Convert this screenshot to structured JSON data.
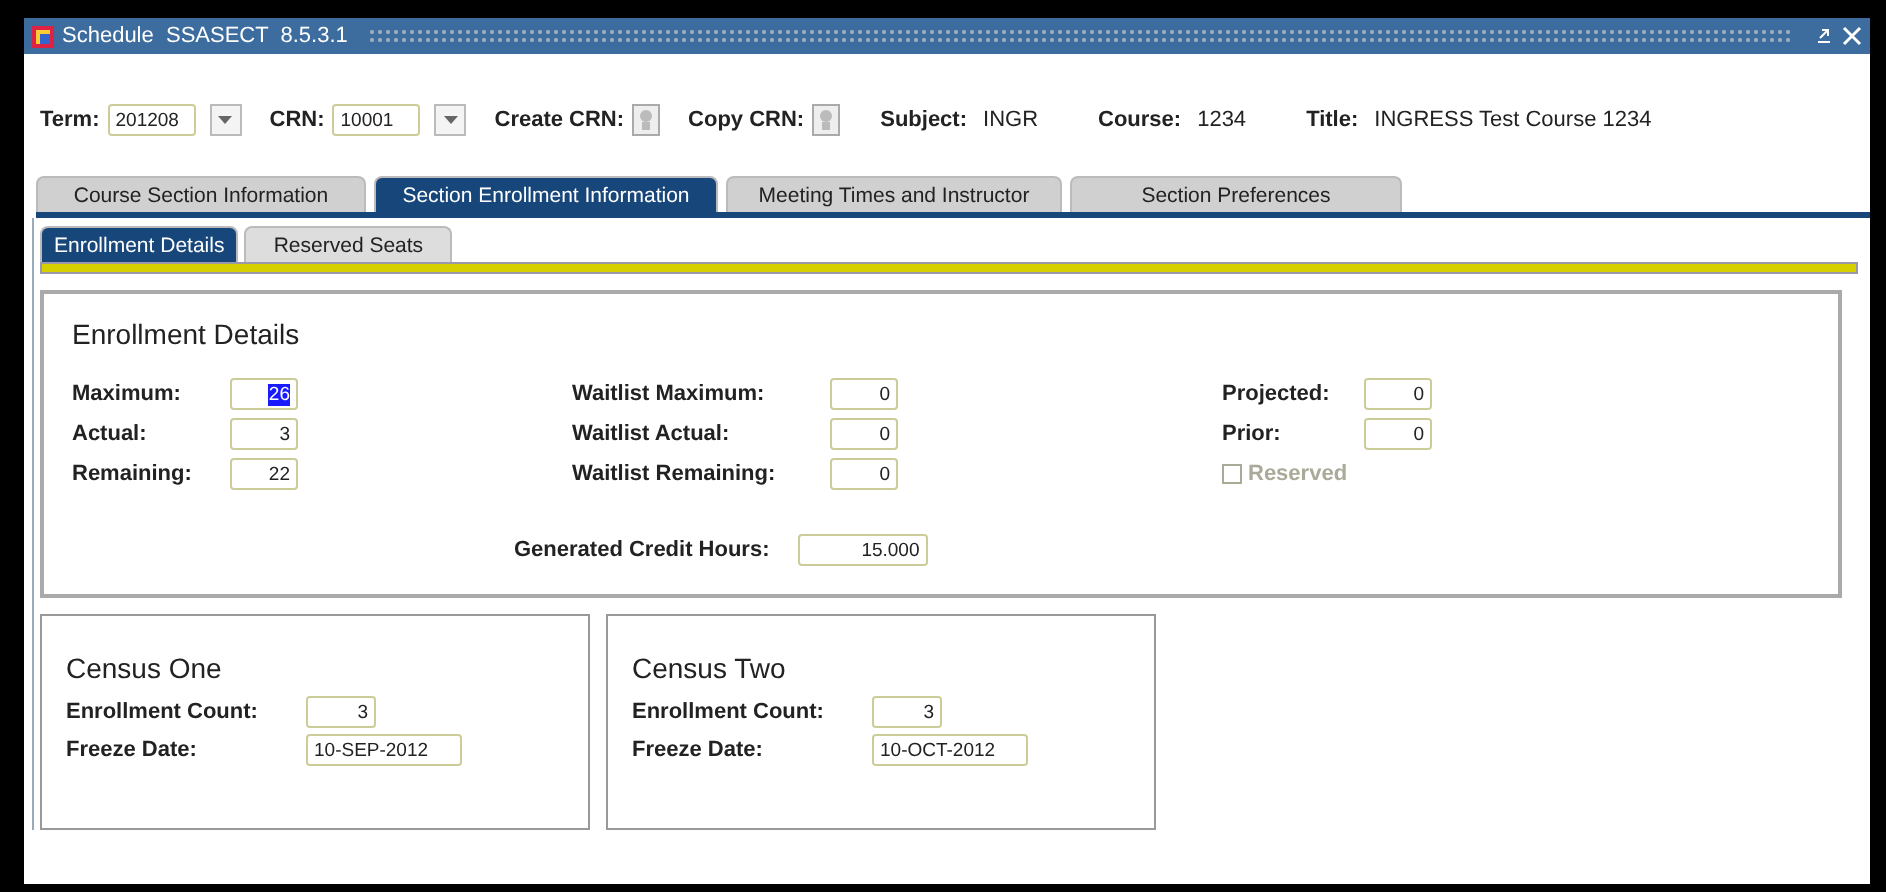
{
  "window": {
    "title": "Schedule  SSASECT  8.5.3.1"
  },
  "header": [
    {
      "label": "Term:",
      "value": "201208",
      "kind": "lookup"
    },
    {
      "label": "CRN:",
      "value": "10001",
      "kind": "lookup"
    },
    {
      "label": "Create CRN:",
      "kind": "button"
    },
    {
      "label": "Copy CRN:",
      "kind": "button"
    },
    {
      "label": "Subject:",
      "value": "INGR",
      "kind": "text"
    },
    {
      "label": "Course:",
      "value": "1234",
      "kind": "text"
    },
    {
      "label": "Title:",
      "value": "INGRESS Test Course 1234",
      "kind": "text"
    }
  ],
  "tabs": [
    {
      "label": "Course Section Information",
      "selected": false
    },
    {
      "label": "Section Enrollment Information",
      "selected": true
    },
    {
      "label": "Meeting Times and Instructor",
      "selected": false
    },
    {
      "label": "Section Preferences",
      "selected": false
    }
  ],
  "subtabs": [
    {
      "label": "Enrollment Details",
      "selected": true
    },
    {
      "label": "Reserved Seats",
      "selected": false
    }
  ],
  "enrollment": {
    "title": "Enrollment Details",
    "rows": [
      [
        {
          "label": "Maximum:",
          "value": "26",
          "selected": true
        },
        {
          "label": "Waitlist Maximum:",
          "value": "0",
          "selected": false
        },
        {
          "label": "Projected:",
          "value": "0",
          "selected": false
        }
      ],
      [
        {
          "label": "Actual:",
          "value": "3",
          "selected": false
        },
        {
          "label": "Waitlist Actual:",
          "value": "0",
          "selected": false
        },
        {
          "label": "Prior:",
          "value": "0",
          "selected": false
        }
      ],
      [
        {
          "label": "Remaining:",
          "value": "22",
          "selected": false
        },
        {
          "label": "Waitlist Remaining:",
          "value": "0",
          "selected": false
        }
      ]
    ],
    "reserved": {
      "label": "Reserved",
      "checked": false,
      "disabled": true
    },
    "credit_hours": {
      "label": "Generated Credit Hours:",
      "value": "15.000"
    }
  },
  "census": [
    {
      "title": "Census One",
      "count_label": "Enrollment Count:",
      "count": "3",
      "date_label": "Freeze Date:",
      "date": "10-SEP-2012"
    },
    {
      "title": "Census Two",
      "count_label": "Enrollment Count:",
      "count": "3",
      "date_label": "Freeze Date:",
      "date": "10-OCT-2012"
    }
  ]
}
